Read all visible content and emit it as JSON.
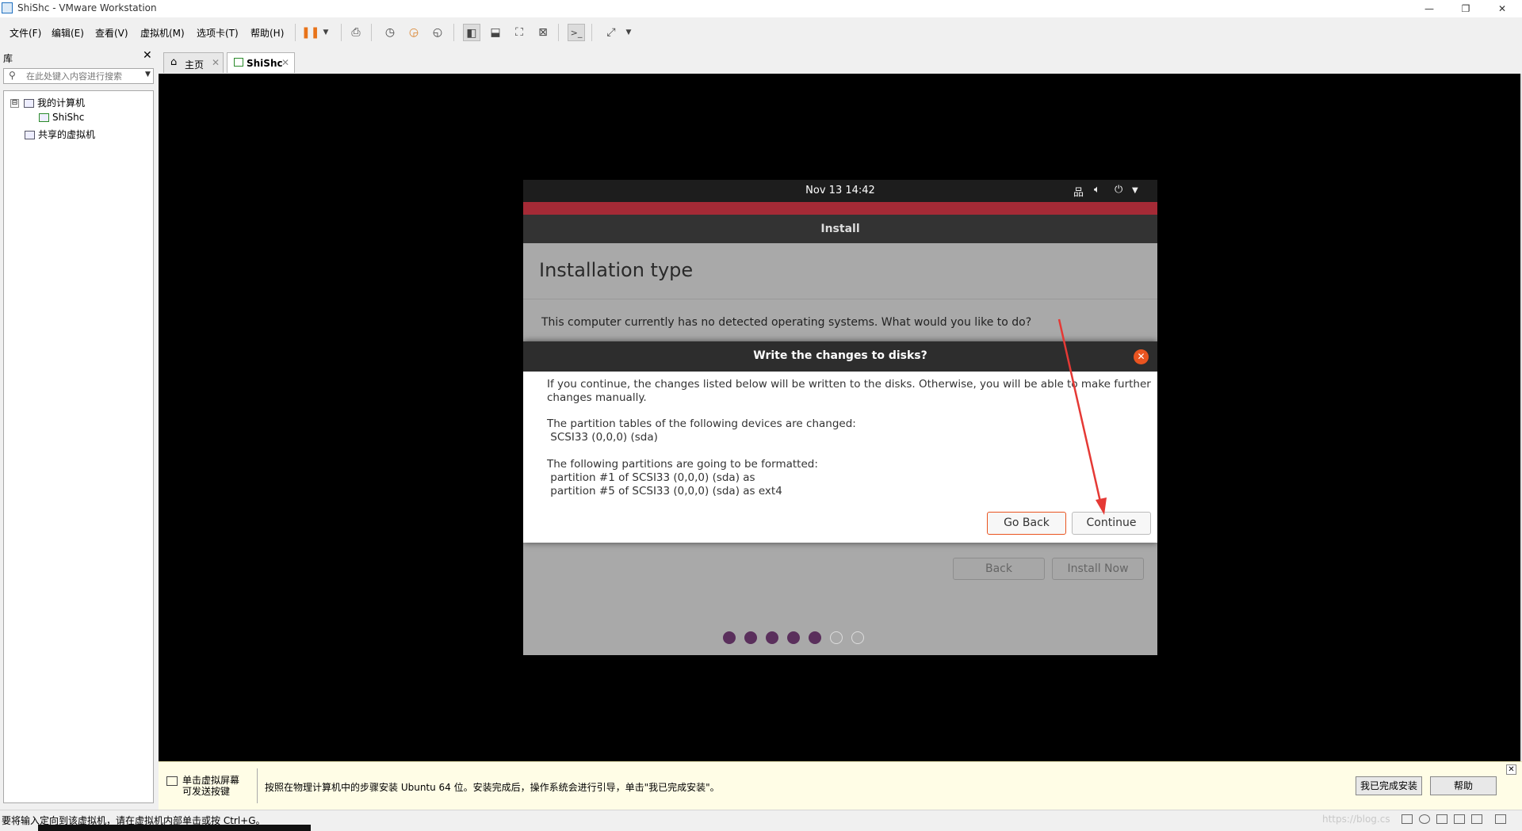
{
  "window": {
    "title": "ShiShc - VMware Workstation",
    "controls": {
      "minimize": "—",
      "restore": "❐",
      "close": "✕"
    }
  },
  "menu": [
    "文件(F)",
    "编辑(E)",
    "查看(V)",
    "虚拟机(M)",
    "选项卡(T)",
    "帮助(H)"
  ],
  "toolbar_icons": [
    "pause-icon",
    "dropdown-icon",
    "send-ctrl-alt-del-icon",
    "snapshot-icon",
    "revert-snapshot-icon",
    "snapshot-manager-icon",
    "library-view-icon",
    "thumbnail-view-icon",
    "fullscreen-icon",
    "unity-icon",
    "console-icon",
    "stretch-icon"
  ],
  "library": {
    "title": "库",
    "close": "✕",
    "search_placeholder": "在此处键入内容进行搜索",
    "tree": {
      "root": "我的计算机",
      "vm": "ShiShc",
      "shared": "共享的虚拟机",
      "expander": "⊟"
    }
  },
  "tabs": [
    {
      "label": "主页",
      "icon": "home-icon",
      "active": false
    },
    {
      "label": "ShiShc",
      "icon": "vm-icon",
      "active": true
    }
  ],
  "tab_close": "✕",
  "ubuntu": {
    "clock": "Nov 13  14:42",
    "tray_icons": [
      "network-icon",
      "volume-icon",
      "power-icon",
      "chevron-down-icon"
    ],
    "header": "Install",
    "page_title": "Installation type",
    "question": "This computer currently has no detected operating systems. What would you like to do?",
    "back_label": "Back",
    "install_now_label": "Install Now",
    "progress": {
      "total": 7,
      "completed": 5
    }
  },
  "dialog": {
    "title": "Write the changes to disks?",
    "close": "✕",
    "lines": [
      "If you continue, the changes listed below will be written to the disks. Otherwise, you will be able to make further",
      "changes manually.",
      "The partition tables of the following devices are changed:",
      " SCSI33 (0,0,0) (sda)",
      "The following partitions are going to be formatted:",
      " partition #1 of SCSI33 (0,0,0) (sda) as",
      " partition #5 of SCSI33 (0,0,0) (sda) as ext4"
    ],
    "go_back_label": "Go Back",
    "continue_label": "Continue"
  },
  "hint": {
    "short": "单击虚拟屏幕\n可发送按键",
    "long": "按照在物理计算机中的步骤安装 Ubuntu 64 位。安装完成后，操作系统会进行引导，单击\"我已完成安装\"。",
    "done_label": "我已完成安装",
    "help_label": "帮助",
    "close": "✕"
  },
  "status": {
    "text": "要将输入定向到该虚拟机，请在虚拟机内部单击或按 Ctrl+G。",
    "watermark": "https://blog.cs"
  },
  "colors": {
    "ubuntu_orange": "#e95420",
    "ubuntu_red_strip": "#a52a36",
    "progress_purple": "#5a2f5c",
    "annotation_arrow": "#e53935"
  }
}
